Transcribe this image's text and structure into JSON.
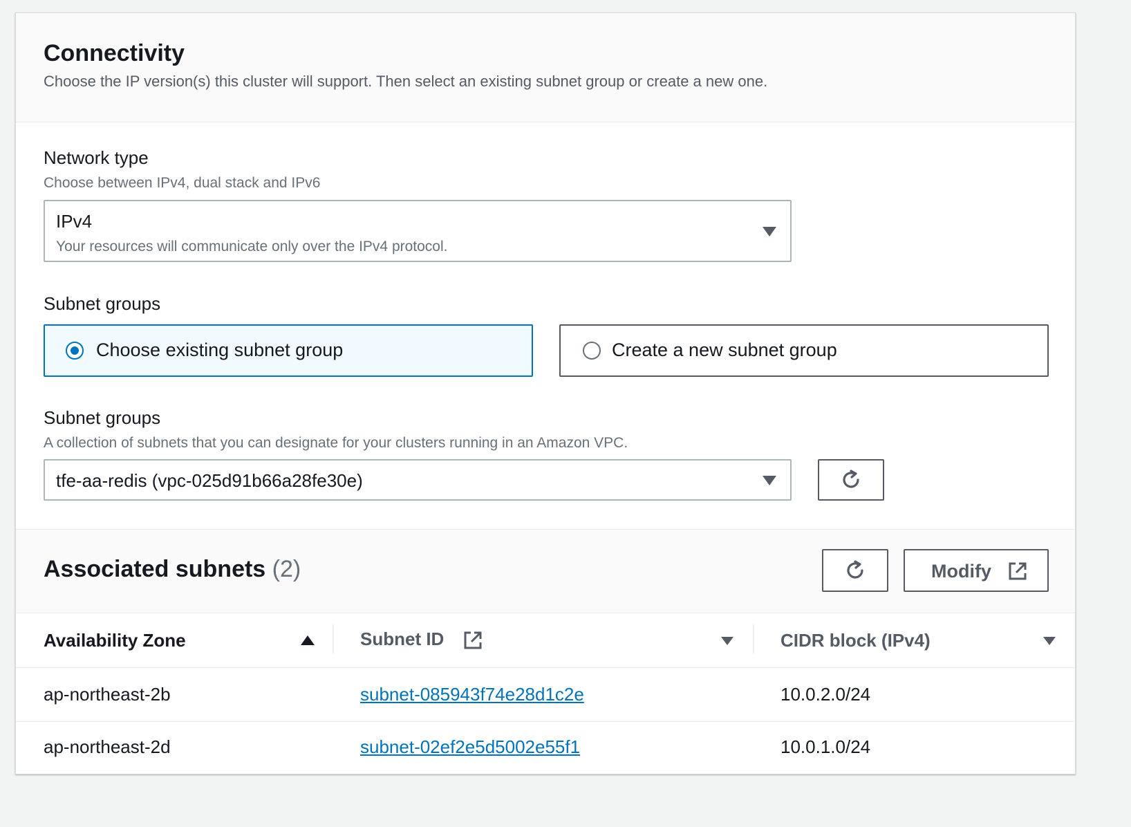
{
  "header": {
    "title": "Connectivity",
    "description": "Choose the IP version(s) this cluster will support. Then select an existing subnet group or create a new one."
  },
  "network_type": {
    "label": "Network type",
    "description": "Choose between IPv4, dual stack and IPv6",
    "selected_value": "IPv4",
    "selected_description": "Your resources will communicate only over the IPv4 protocol."
  },
  "subnet_group_choice": {
    "label": "Subnet groups",
    "options": [
      {
        "label": "Choose existing subnet group",
        "selected": true
      },
      {
        "label": "Create a new subnet group",
        "selected": false
      }
    ]
  },
  "subnet_groups": {
    "label": "Subnet groups",
    "description": "A collection of subnets that you can designate for your clusters running in an Amazon VPC.",
    "selected_value": "tfe-aa-redis (vpc-025d91b66a28fe30e)"
  },
  "associated_subnets": {
    "title": "Associated subnets",
    "count": "(2)",
    "modify_label": "Modify",
    "columns": [
      "Availability Zone",
      "Subnet ID",
      "CIDR block (IPv4)"
    ],
    "rows": [
      {
        "zone": "ap-northeast-2b",
        "subnet_id": "subnet-085943f74e28d1c2e",
        "cidr": "10.0.2.0/24"
      },
      {
        "zone": "ap-northeast-2d",
        "subnet_id": "subnet-02ef2e5d5002e55f1",
        "cidr": "10.0.1.0/24"
      }
    ]
  },
  "colors": {
    "accent": "#0073bb",
    "selected_tile_bg": "#f1faff",
    "border": "#aab7b8"
  },
  "icons": {
    "dropdown": "caret-down-icon",
    "refresh": "refresh-icon",
    "external": "external-link-icon",
    "sort": "sort-ascending-icon"
  }
}
